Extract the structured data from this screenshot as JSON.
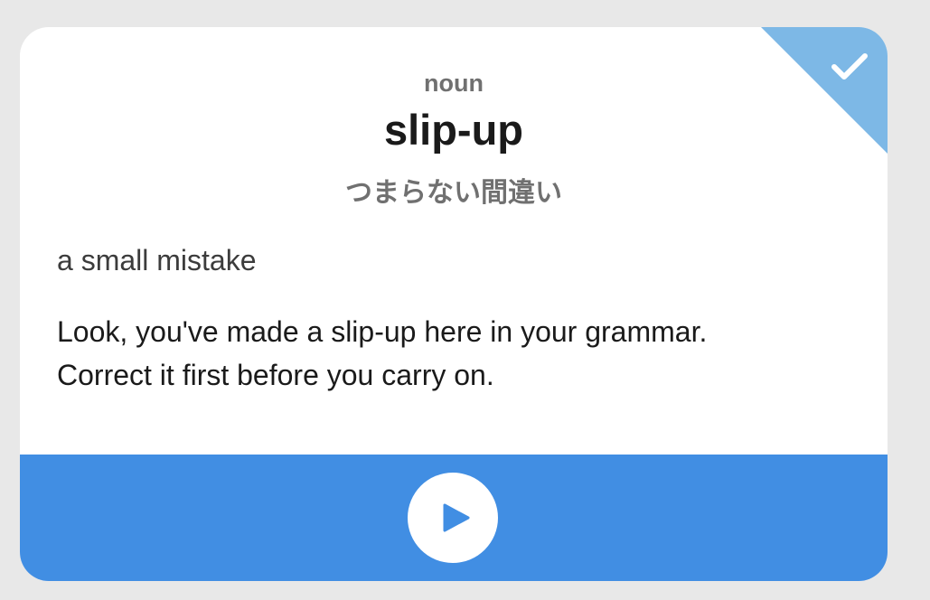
{
  "card": {
    "part_of_speech": "noun",
    "word": "slip-up",
    "translation": "つまらない間違い",
    "definition": "a small mistake",
    "example_line1": "Look, you've made a slip-up here in your grammar.",
    "example_line2": "Correct it first before you carry on."
  },
  "status": {
    "icon": "check-icon",
    "color": "#7db8e6"
  },
  "footer": {
    "color": "#418ee3",
    "play_icon": "play-icon"
  }
}
